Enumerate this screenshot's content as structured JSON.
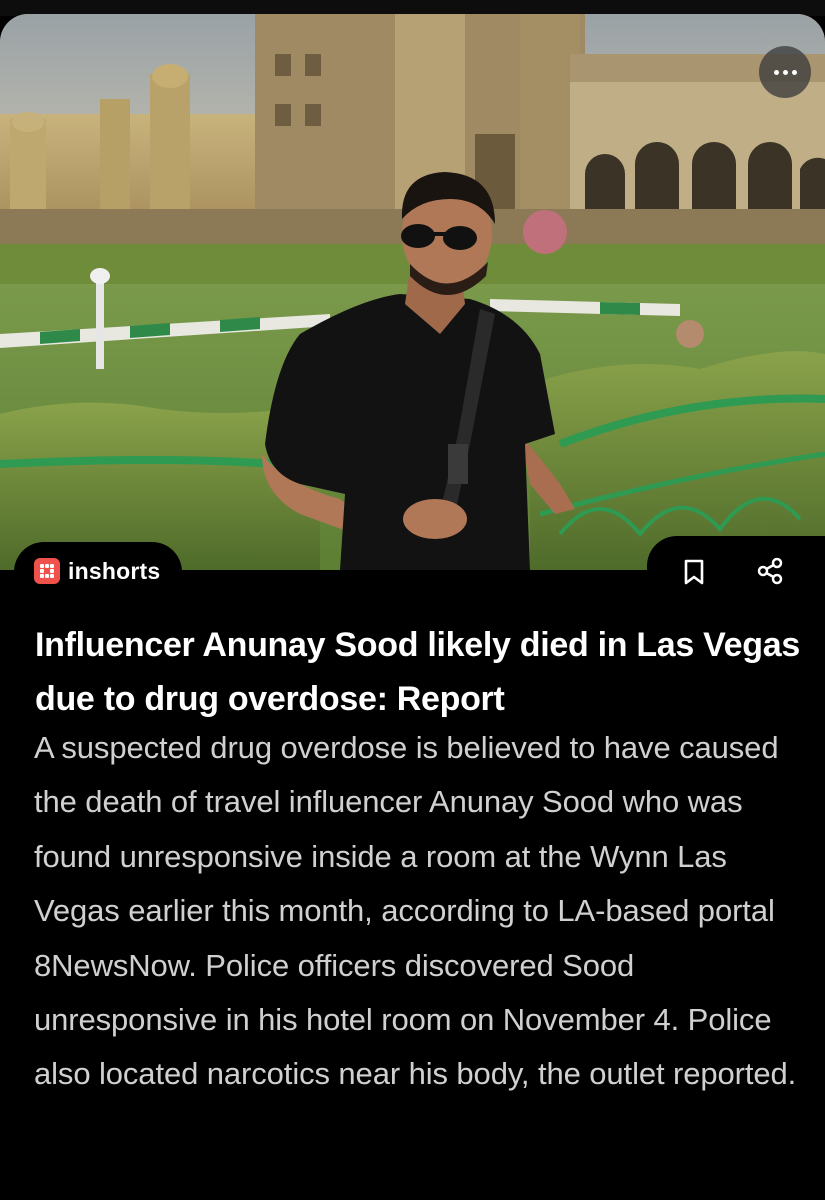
{
  "hero": {
    "image_icon": "photo-man-in-black-shirt-palace-garden",
    "more_icon": "more-horizontal-icon"
  },
  "brand": {
    "name": "inshorts",
    "color": "#f0514b"
  },
  "actions": {
    "bookmark_icon": "bookmark-icon",
    "share_icon": "share-icon"
  },
  "article": {
    "headline": "Influencer Anunay Sood likely died in Las Vegas due to drug overdose: Report",
    "body": "A suspected drug overdose is believed to have caused the death of travel influencer Anunay Sood who was found unresponsive inside a room at the Wynn Las Vegas earlier this month, according to LA-based portal 8NewsNow. Police officers discovered Sood unresponsive in his hotel room on November 4. Police also located narcotics near his body, the outlet reported."
  }
}
